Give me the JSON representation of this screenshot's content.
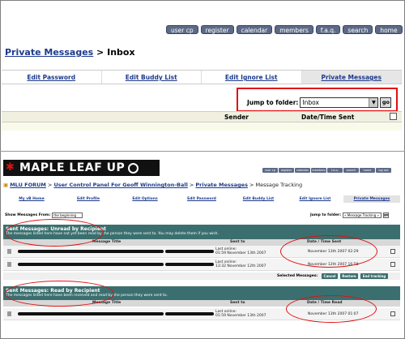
{
  "top_nav": [
    "user cp",
    "register",
    "calendar",
    "members",
    "f.a.q.",
    "search",
    "home"
  ],
  "crumb1": {
    "link": "Private Messages",
    "rest": " > Inbox"
  },
  "tabs1": [
    "Edit Password",
    "Edit Buddy List",
    "Edit Ignore List",
    "Private Messages"
  ],
  "jump1": {
    "label": "Jump to folder:",
    "value": "Inbox",
    "go": "go"
  },
  "table1_headers": {
    "sender": "Sender",
    "datetime": "Date/Time Sent"
  },
  "logo": {
    "text": "MAPLE LEAF UP"
  },
  "top_nav2": [
    "user cp",
    "register",
    "calendar",
    "members",
    "f.a.q.",
    "search",
    "home",
    "log out"
  ],
  "crumb2": {
    "forum": "MLU FORUM",
    "sep": " > ",
    "cp": "User Control Panel For Geoff Winnington-Ball",
    "pm": "Private Messages",
    "rest": " > Message Tracking"
  },
  "tabs2": [
    "My vB Home",
    "Edit Profile",
    "Edit Options",
    "Edit Password",
    "Edit Buddy List",
    "Edit Ignore List",
    "Private Messages"
  ],
  "show_messages": {
    "label": "Show Messages From:",
    "value": "the beginning"
  },
  "jump2": {
    "label": "Jump to folder:",
    "value": "« Message Tracking »",
    "go": "go"
  },
  "section1": {
    "title": "Sent Messages: Unread by Recipient",
    "desc": "The messages listed here have not yet been read by the person they were sent to. You may delete them if you wish."
  },
  "section2": {
    "title": "Sent Messages: Read by Recipient",
    "desc": "The messages listed here have been received and read by the person they were sent to."
  },
  "col_headers1": {
    "title": "Message Title",
    "sent_to": "Sent to",
    "date": "Date / Time Sent"
  },
  "col_headers2": {
    "title": "Message Title",
    "sent_to": "Sent to",
    "date": "Date / Time Read"
  },
  "rows1": [
    {
      "lastonline": "Last online:",
      "lastonline_date": "01:59 November 13th 2007",
      "date": "November 13th 2007 02:29"
    },
    {
      "lastonline": "Last online:",
      "lastonline_date": "13:32 November 12th 2007",
      "date": "November 12th 2007 16:58"
    }
  ],
  "selected_bar": {
    "label": "Selected Messages:",
    "cancel": "Cancel",
    "restore": "Restore",
    "end": "End tracking"
  },
  "rows2": [
    {
      "lastonline": "Last online:",
      "lastonline_date": "01:59 November 13th 2007",
      "date": "November 13th 2007 01:07"
    }
  ],
  "colors": {
    "highlight": "#e01010",
    "section": "#3b6f6f",
    "nav": "#5d6a87",
    "link": "#1c3a8c"
  }
}
